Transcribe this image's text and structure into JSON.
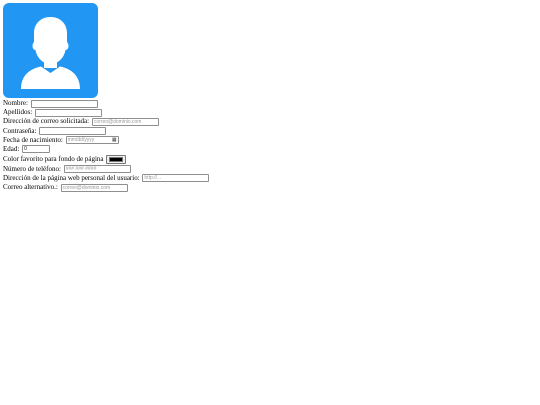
{
  "avatar": {
    "icon": "user-silhouette-icon",
    "background": "#2196f3"
  },
  "form": {
    "nombre": {
      "label": "Nombre:",
      "value": "",
      "placeholder": ""
    },
    "apellidos": {
      "label": "Apellidos:",
      "value": "",
      "placeholder": ""
    },
    "correo": {
      "label": "Dirección de correo solicitada:",
      "placeholder": "correo@dominio.com"
    },
    "contrasena": {
      "label": "Contraseña:",
      "value": ""
    },
    "fecha": {
      "label": "Fecha de nacimiento:",
      "placeholder": "mm/dd/yyyy"
    },
    "edad": {
      "label": "Edad:",
      "value": "0"
    },
    "color": {
      "label": "Color favorito para fondo de página",
      "value": "#000000"
    },
    "telefono": {
      "label": "Número de teléfono:",
      "placeholder": "### ### ####"
    },
    "web": {
      "label": "Dirección de la página web personal del usuario:",
      "placeholder": "http://..."
    },
    "correo_alt": {
      "label": "Correo alternativo.:",
      "placeholder": "correo@dominio.com"
    }
  }
}
